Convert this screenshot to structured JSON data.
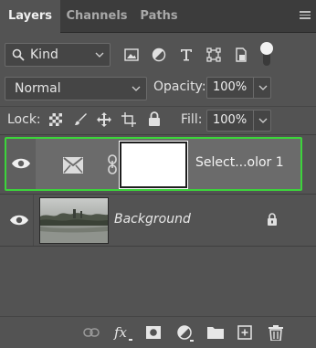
{
  "tabs": [
    {
      "label": "Layers",
      "active": true
    },
    {
      "label": "Channels",
      "active": false
    },
    {
      "label": "Paths",
      "active": false
    }
  ],
  "filter": {
    "kind_label": "Kind"
  },
  "blend": {
    "mode": "Normal",
    "opacity_label": "Opacity:",
    "opacity_value": "100%"
  },
  "lock": {
    "label": "Lock:",
    "fill_label": "Fill:",
    "fill_value": "100%"
  },
  "layers": [
    {
      "name": "Select...olor 1",
      "selected": true,
      "visible": true
    },
    {
      "name": "Background",
      "selected": false,
      "visible": true,
      "locked": true
    }
  ],
  "colors": {
    "selection_outline": "#3cd43b",
    "panel_bg": "#535353",
    "tab_bar_bg": "#3c3c3c"
  }
}
